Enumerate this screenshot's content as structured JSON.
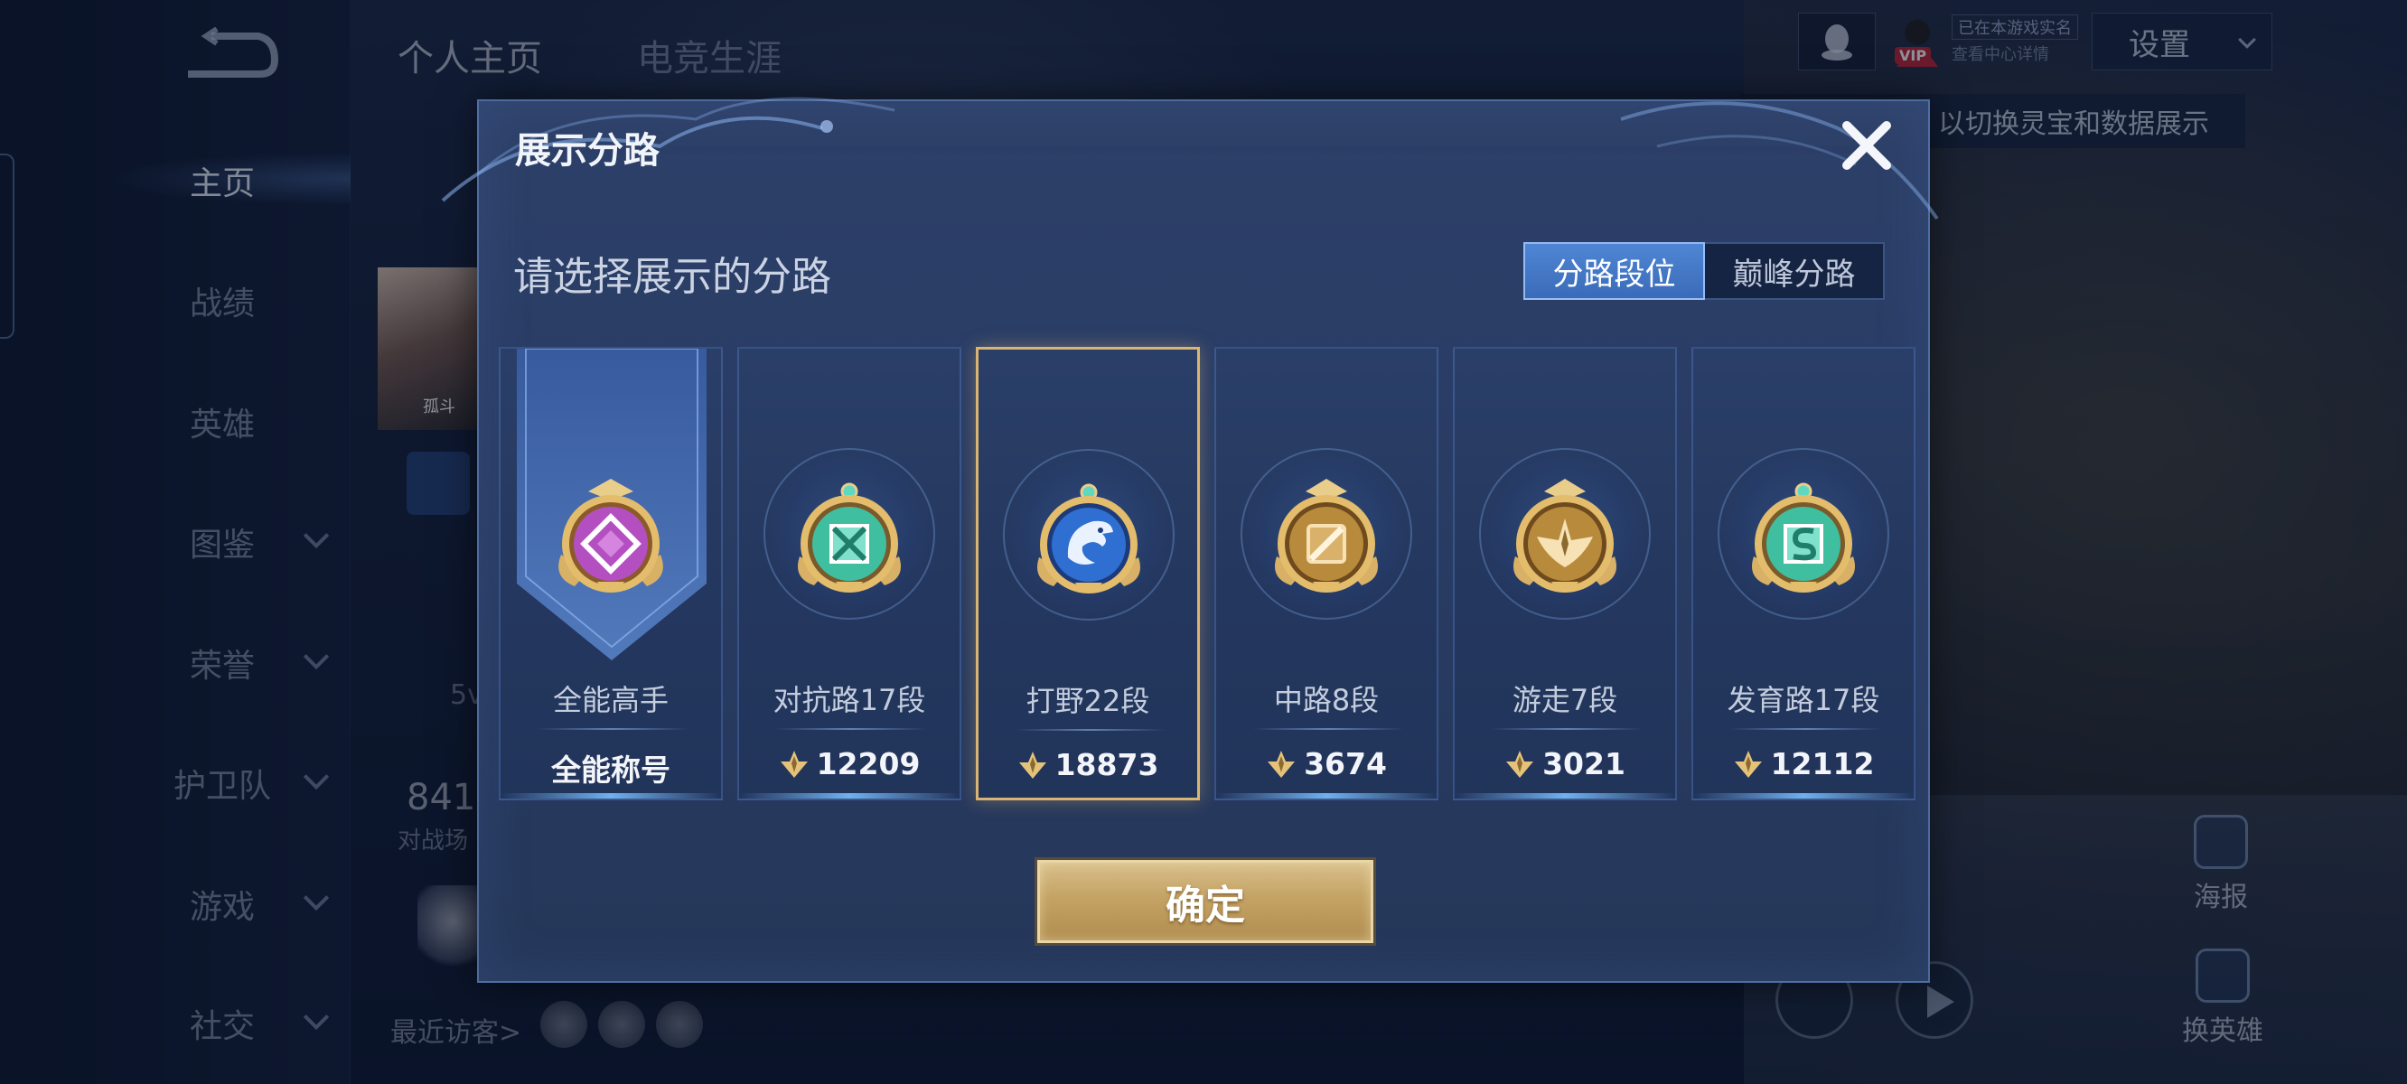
{
  "sidebar": {
    "items": [
      {
        "label": "主页",
        "active": true
      },
      {
        "label": "战绩"
      },
      {
        "label": "英雄"
      },
      {
        "label": "图鉴"
      },
      {
        "label": "荣誉"
      },
      {
        "label": "护卫队"
      },
      {
        "label": "游戏"
      },
      {
        "label": "社交"
      }
    ]
  },
  "header": {
    "tabs": [
      "个人主页",
      "电竞生涯"
    ],
    "settings_label": "设置",
    "vip_label": "VIP",
    "vip_status_1": "已在本游戏实名",
    "vip_status_2": "查看中心详情",
    "hint": "以切换灵宝和数据展示"
  },
  "profile": {
    "photo_caption": "孤斗",
    "stat_5v": "5v",
    "stat_841": "841",
    "stat_841_sub": "对战场",
    "recent_visitors": "最近访客>"
  },
  "right_buttons": {
    "poster": "海报",
    "swap_hero": "换英雄"
  },
  "modal": {
    "title": "展示分路",
    "prompt": "请选择展示的分路",
    "toggle": [
      "分路段位",
      "巅峰分路"
    ],
    "active_toggle": 0,
    "cards": [
      {
        "name": "全能高手",
        "score": "全能称号",
        "badge": "all-round-badge-icon",
        "color": "#b34fc0"
      },
      {
        "name": "对抗路17段",
        "score": "12209",
        "badge": "clash-lane-badge-icon",
        "color": "#3fbf9f"
      },
      {
        "name": "打野22段",
        "score": "18873",
        "badge": "jungle-badge-icon",
        "color": "#2f6fd1",
        "selected": true
      },
      {
        "name": "中路8段",
        "score": "3674",
        "badge": "mid-lane-badge-icon",
        "color": "#b88a3c"
      },
      {
        "name": "游走7段",
        "score": "3021",
        "badge": "roam-badge-icon",
        "color": "#b88a3c"
      },
      {
        "name": "发育路17段",
        "score": "12112",
        "badge": "farm-lane-badge-icon",
        "color": "#3fbf9f"
      }
    ],
    "confirm_label": "确定"
  }
}
